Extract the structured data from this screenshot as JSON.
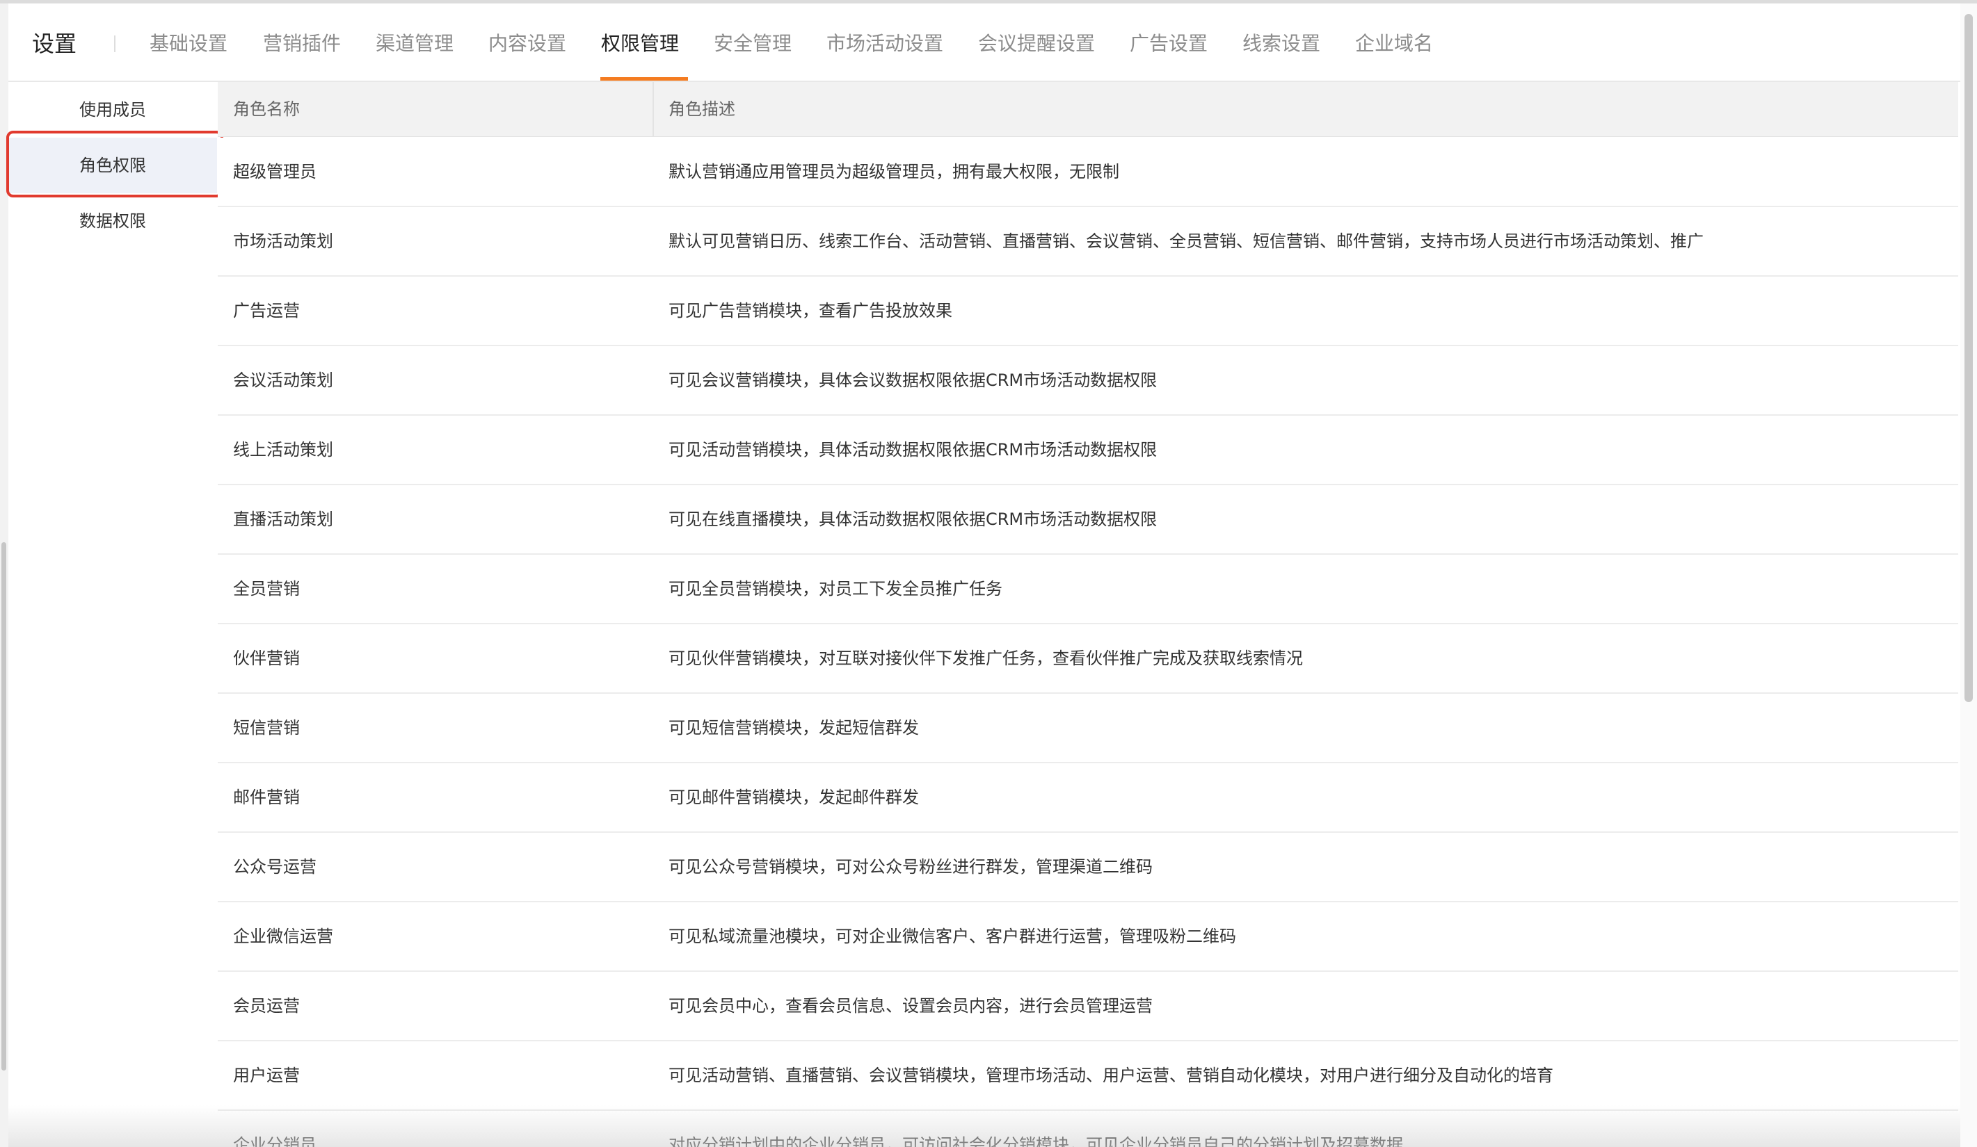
{
  "header": {
    "title": "设置",
    "tabs": [
      {
        "label": "基础设置"
      },
      {
        "label": "营销插件"
      },
      {
        "label": "渠道管理"
      },
      {
        "label": "内容设置"
      },
      {
        "label": "权限管理",
        "active": true
      },
      {
        "label": "安全管理"
      },
      {
        "label": "市场活动设置"
      },
      {
        "label": "会议提醒设置"
      },
      {
        "label": "广告设置"
      },
      {
        "label": "线索设置"
      },
      {
        "label": "企业域名"
      }
    ]
  },
  "sidebar": {
    "items": [
      {
        "label": "使用成员"
      },
      {
        "label": "角色权限",
        "active": true
      },
      {
        "label": "数据权限"
      }
    ]
  },
  "table": {
    "columns": [
      "角色名称",
      "角色描述"
    ],
    "rows": [
      {
        "name": "超级管理员",
        "desc": "默认营销通应用管理员为超级管理员，拥有最大权限，无限制"
      },
      {
        "name": "市场活动策划",
        "desc": "默认可见营销日历、线索工作台、活动营销、直播营销、会议营销、全员营销、短信营销、邮件营销，支持市场人员进行市场活动策划、推广"
      },
      {
        "name": "广告运营",
        "desc": "可见广告营销模块，查看广告投放效果"
      },
      {
        "name": "会议活动策划",
        "desc": "可见会议营销模块，具体会议数据权限依据CRM市场活动数据权限"
      },
      {
        "name": "线上活动策划",
        "desc": "可见活动营销模块，具体活动数据权限依据CRM市场活动数据权限"
      },
      {
        "name": "直播活动策划",
        "desc": "可见在线直播模块，具体活动数据权限依据CRM市场活动数据权限"
      },
      {
        "name": "全员营销",
        "desc": "可见全员营销模块，对员工下发全员推广任务"
      },
      {
        "name": "伙伴营销",
        "desc": "可见伙伴营销模块，对互联对接伙伴下发推广任务，查看伙伴推广完成及获取线索情况"
      },
      {
        "name": "短信营销",
        "desc": "可见短信营销模块，发起短信群发"
      },
      {
        "name": "邮件营销",
        "desc": "可见邮件营销模块，发起邮件群发"
      },
      {
        "name": "公众号运营",
        "desc": "可见公众号营销模块，可对公众号粉丝进行群发，管理渠道二维码"
      },
      {
        "name": "企业微信运营",
        "desc": "可见私域流量池模块，可对企业微信客户、客户群进行运营，管理吸粉二维码"
      },
      {
        "name": "会员运营",
        "desc": "可见会员中心，查看会员信息、设置会员内容，进行会员管理运营"
      },
      {
        "name": "用户运营",
        "desc": "可见活动营销、直播营销、会议营销模块，管理市场活动、用户运营、营销自动化模块，对用户进行细分及自动化的培育"
      },
      {
        "name": "企业分销员",
        "desc": "对应分销计划中的企业分销员，可访问社会化分销模块，可见企业分销员自己的分销计划及招募数据"
      }
    ]
  },
  "colors": {
    "accent": "#f47b20",
    "highlight": "#e13a2e",
    "active_bg": "#eef1f8"
  }
}
